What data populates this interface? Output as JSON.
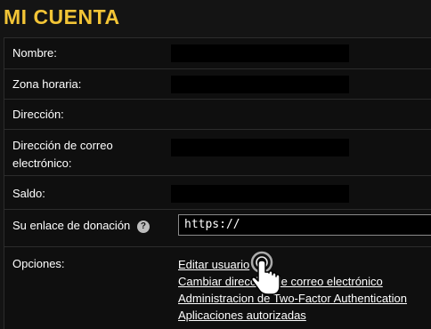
{
  "page": {
    "title": "MI CUENTA"
  },
  "rows": {
    "nombre": {
      "label": "Nombre:"
    },
    "zona": {
      "label": "Zona horaria:"
    },
    "direccion": {
      "label": "Dirección:"
    },
    "correo": {
      "label_1": "Dirección de correo",
      "label_2": "electrónico:"
    },
    "saldo": {
      "label": "Saldo:"
    },
    "donacion": {
      "label": "Su enlace de donación",
      "help_icon": "?",
      "value": "https://"
    },
    "opciones": {
      "label": "Opciones:",
      "links": [
        "Editar usuario",
        "Cambiar dirección de correo electrónico",
        "Administracion de Two-Factor Authentication",
        "Aplicaciones autorizadas"
      ]
    }
  },
  "colors": {
    "title": "#f2c436",
    "background": "#141414"
  }
}
